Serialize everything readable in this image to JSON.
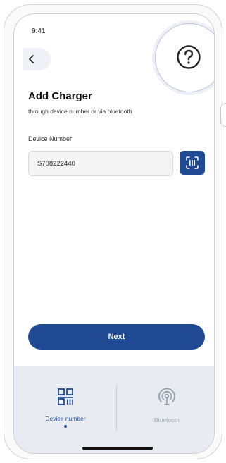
{
  "status_bar": {
    "time": "9:41"
  },
  "header": {
    "back_icon": "chevron-left-icon",
    "help_icon": "question-circle-icon"
  },
  "page": {
    "title": "Add Charger",
    "subtitle": "through device number or via bluetooth",
    "field_label": "Device Number",
    "device_number_value": "S708222440",
    "scan_icon": "barcode-scan-icon",
    "next_label": "Next"
  },
  "bottom_nav": {
    "items": [
      {
        "label": "Device number",
        "icon": "qr-code-icon",
        "active": true
      },
      {
        "label": "Bluetooth",
        "icon": "wireless-signal-icon",
        "active": false
      }
    ]
  },
  "colors": {
    "primary": "#1f4a93",
    "nav_bg": "#e8ebf2",
    "input_bg": "#f5f5f5"
  }
}
